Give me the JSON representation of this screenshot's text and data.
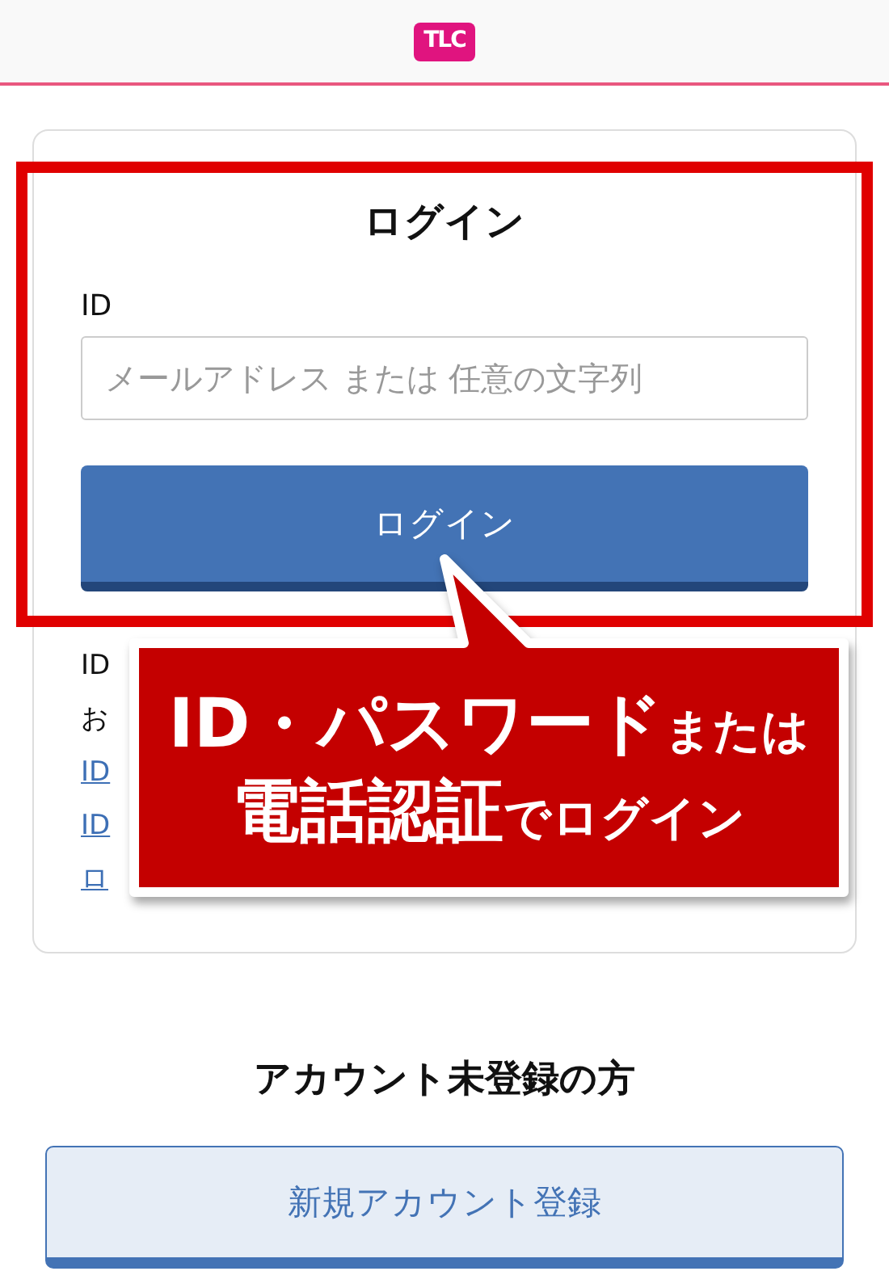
{
  "header": {
    "logo": "TLC"
  },
  "login": {
    "title": "ログイン",
    "id_field": {
      "label": "ID",
      "placeholder": "メールアドレス または 任意の文字列"
    },
    "button": "ログイン",
    "notes": [
      "ID",
      "お"
    ],
    "links": [
      "ID",
      "ID",
      "ロ"
    ]
  },
  "callout": {
    "lines": [
      {
        "large": "ID・パスワード",
        "small": "または"
      },
      {
        "large": "電話認証",
        "small": "でログイン"
      }
    ]
  },
  "register": {
    "title": "アカウント未登録の方",
    "button": "新規アカウント登録"
  }
}
